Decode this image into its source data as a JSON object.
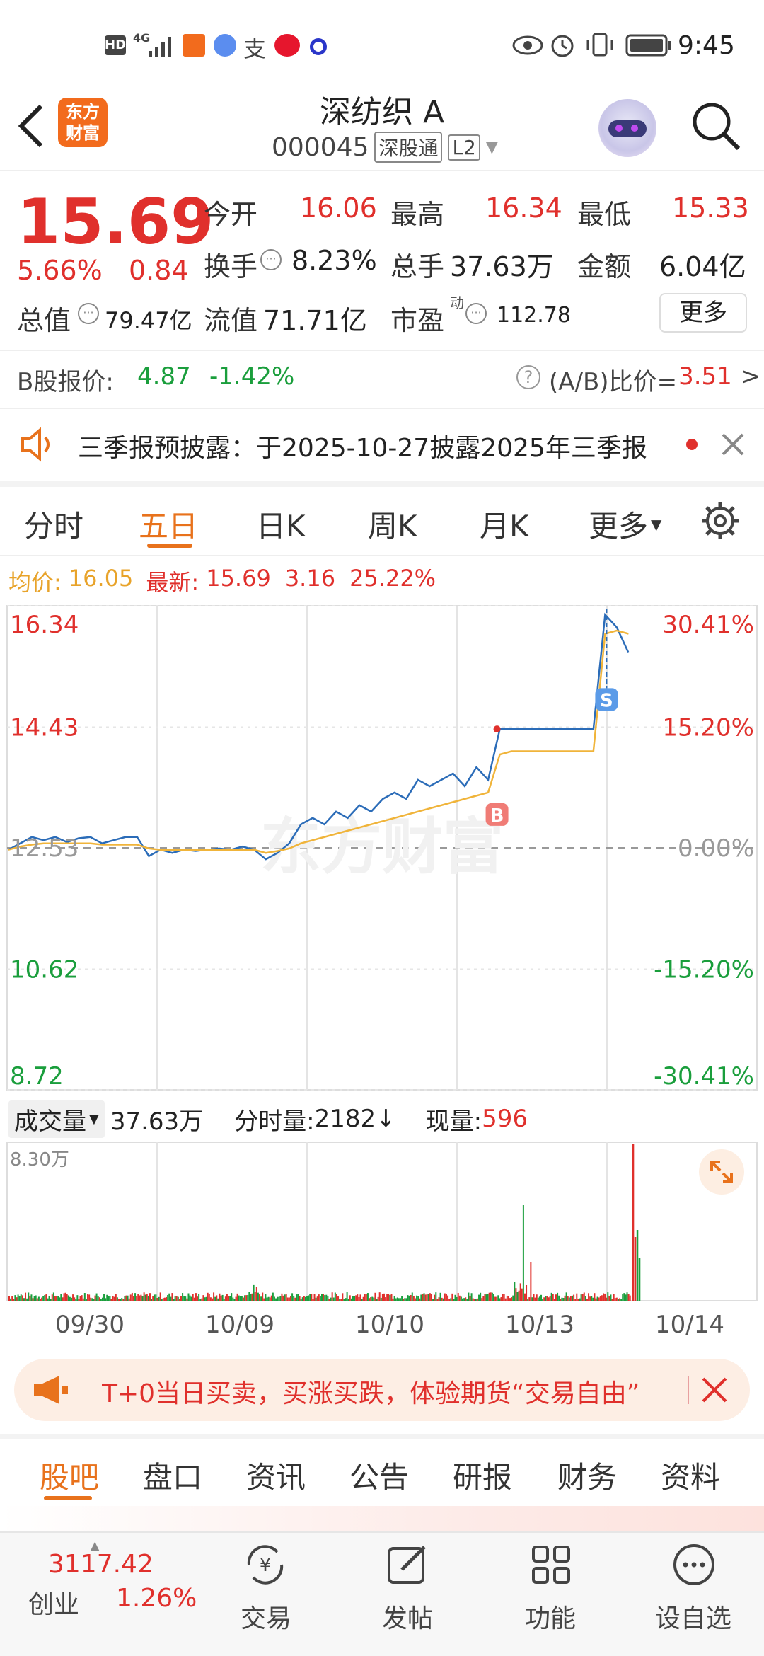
{
  "status_bar": {
    "time": "9:45",
    "net": "HD",
    "signal": "4G"
  },
  "header": {
    "brand_line1": "东方",
    "brand_line2": "财富",
    "stock_name": "深纺织 A",
    "stock_code": "000045",
    "tag_sgt": "深股通",
    "tag_l2": "L2"
  },
  "quote": {
    "price": "15.69",
    "change_pct": "5.66%",
    "change": "0.84",
    "open_label": "今开",
    "open": "16.06",
    "high_label": "最高",
    "high": "16.34",
    "low_label": "最低",
    "low": "15.33",
    "turnover_label": "换手",
    "turnover": "8.23%",
    "volume_label": "总手",
    "volume": "37.63万",
    "amount_label": "金额",
    "amount": "6.04亿",
    "mktcap_label": "总值",
    "mktcap": "79.47亿",
    "float_label": "流值",
    "float": "71.71亿",
    "pe_label": "市盈",
    "pe_sup": "动",
    "pe": "112.78",
    "more_button": "更多"
  },
  "b_share": {
    "label": "B股报价:",
    "price": "4.87",
    "change": "-1.42%",
    "ratio_label": "(A/B)比价=",
    "ratio": "3.51",
    "arrow": ">"
  },
  "notice": {
    "text": "三季报预披露：于2025-10-27披露2025年三季报"
  },
  "chart_tabs": [
    "分时",
    "五日",
    "日K",
    "周K",
    "月K",
    "更多"
  ],
  "chart_header": {
    "avg_label": "均价:",
    "avg": "16.05",
    "latest_label": "最新:",
    "latest": "15.69",
    "chg": "3.16",
    "chg_pct": "25.22%"
  },
  "watermark": "东方财富",
  "volume_header": {
    "label": "成交量",
    "total": "37.63万",
    "tick_label": "分时量:",
    "tick": "2182",
    "tick_arrow": "↓",
    "now_label": "现量:",
    "now": "596",
    "max": "8.30万"
  },
  "chart_data": {
    "type": "line",
    "title": "",
    "y_left": [
      "16.34",
      "14.43",
      "12.53",
      "10.62",
      "8.72"
    ],
    "y_right": [
      "30.41%",
      "15.20%",
      "0.00%",
      "-15.20%",
      "-30.41%"
    ],
    "ylim": [
      8.72,
      16.34
    ],
    "prev_close": 12.53,
    "dates": [
      "09/30",
      "10/09",
      "10/10",
      "10/13",
      "10/14"
    ],
    "series": [
      {
        "values": [
          12.5,
          12.6,
          12.7,
          12.65,
          12.7,
          12.62,
          12.68,
          12.7,
          12.6,
          12.65,
          12.7,
          12.7,
          12.4,
          12.5,
          12.45,
          12.5,
          12.48,
          12.5,
          12.52,
          12.5,
          12.55,
          12.5,
          12.35,
          12.45,
          12.6,
          12.9,
          13.0,
          12.9,
          13.1,
          13.0,
          13.2,
          13.1,
          13.3,
          13.4,
          13.3,
          13.6,
          13.5,
          13.6,
          13.7,
          13.5,
          13.8,
          13.6,
          14.4,
          14.4,
          14.4,
          14.4,
          14.4,
          14.4,
          14.4,
          14.4,
          14.4,
          16.2,
          16.0,
          15.6
        ]
      },
      {
        "values": [
          12.5,
          12.55,
          12.58,
          12.6,
          12.6,
          12.6,
          12.6,
          12.6,
          12.58,
          12.58,
          12.58,
          12.58,
          12.52,
          12.5,
          12.5,
          12.5,
          12.5,
          12.5,
          12.5,
          12.5,
          12.5,
          12.5,
          12.45,
          12.48,
          12.52,
          12.6,
          12.65,
          12.7,
          12.75,
          12.8,
          12.85,
          12.9,
          12.95,
          13.0,
          13.05,
          13.1,
          13.15,
          13.2,
          13.25,
          13.3,
          13.35,
          13.4,
          14.0,
          14.05,
          14.05,
          14.05,
          14.05,
          14.05,
          14.05,
          14.05,
          14.05,
          15.9,
          15.95,
          15.9
        ]
      }
    ],
    "markers": [
      {
        "label": "B"
      },
      {
        "label": "S"
      }
    ]
  },
  "promo": {
    "text": "T+0当日买卖，买涨买跌，体验期货“交易自由”"
  },
  "bottom_tabs": [
    "股吧",
    "盘口",
    "资讯",
    "公告",
    "研报",
    "财务",
    "资料"
  ],
  "bottom_nav": {
    "index_value": "3117.42",
    "index_name": "创业",
    "index_pct": "1.26%",
    "items": [
      "交易",
      "发帖",
      "功能",
      "设自选"
    ]
  }
}
